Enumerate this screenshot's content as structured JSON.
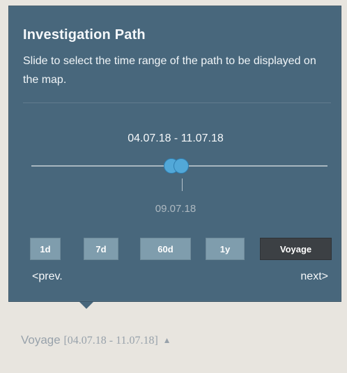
{
  "panel": {
    "title": "Investigation Path",
    "description": "Slide to select the time range of the path to be displayed on the map."
  },
  "slider": {
    "range_label": "04.07.18 - 11.07.18",
    "marker_date": "09.07.18"
  },
  "periods": {
    "one_day": "1d",
    "seven_days": "7d",
    "sixty_days": "60d",
    "one_year": "1y",
    "voyage": "Voyage"
  },
  "navigation": {
    "previous": "<prev.",
    "next": "next>"
  },
  "summary": {
    "label": "Voyage",
    "open_bracket": "[",
    "range": "04.07.18 - 11.07.18",
    "close_bracket": "]",
    "arrow": "▲"
  },
  "colors": {
    "panel": "#48677c",
    "slider_handle": "#52a8d8",
    "button": "#7f9dad",
    "active_button": "#3c4044"
  }
}
